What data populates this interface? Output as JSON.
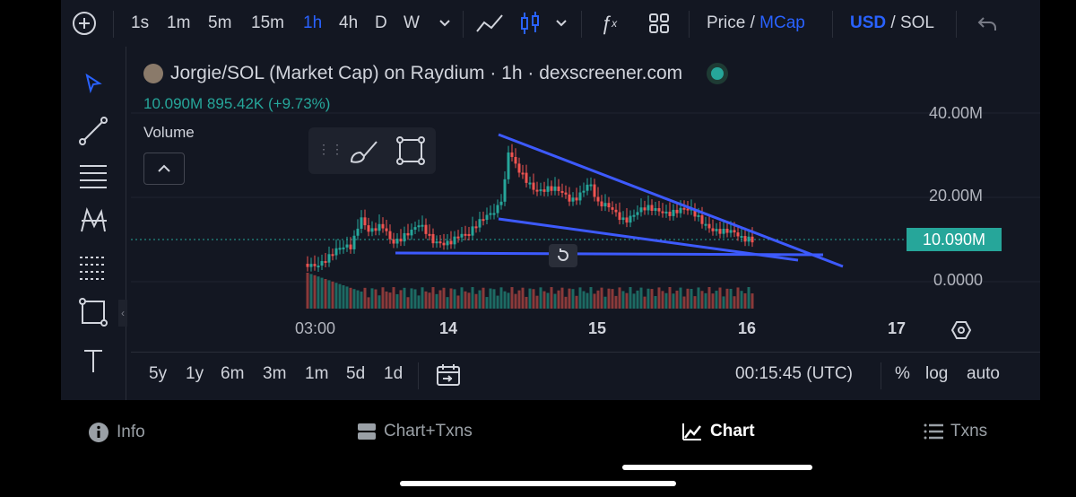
{
  "topbar": {
    "intervals": [
      "1s",
      "1m",
      "5m",
      "15m",
      "1h",
      "4h",
      "D",
      "W"
    ],
    "active_interval": "1h",
    "price_label": "Price /",
    "mcap_label": "MCap",
    "usd_label": "USD",
    "sol_label": "/ SOL"
  },
  "chart": {
    "title": "Jorgie/SOL (Market Cap) on Raydium · 1h · dexscreener.com",
    "last_value": "10.090M",
    "change_value": "895.42K",
    "change_pct": "(+9.73%)",
    "volume_label": "Volume",
    "y_ticks": [
      "40.00M",
      "20.00M",
      "0.0000"
    ],
    "price_tag": "10.090M",
    "x_ticks": [
      "03:00",
      "14",
      "15",
      "16",
      "17"
    ],
    "colors": {
      "up": "#26a69a",
      "down": "#ef5350",
      "trendline": "#3d5afe",
      "bg": "#131722"
    }
  },
  "chart_data": {
    "type": "candlestick",
    "title": "Jorgie/SOL (Market Cap) on Raydium · 1h · dexscreener.com",
    "ylabel": "",
    "ylim": [
      0,
      45000000
    ],
    "x": [
      "03:00",
      "14",
      "15",
      "16",
      "17"
    ],
    "last": 10090000
  },
  "bottombar": {
    "ranges": [
      "5y",
      "1y",
      "6m",
      "3m",
      "1m",
      "5d",
      "1d"
    ],
    "time": "00:15:45 (UTC)",
    "pct": "%",
    "log": "log",
    "auto": "auto"
  },
  "nav": {
    "info": "Info",
    "chart_txns": "Chart+Txns",
    "chart": "Chart",
    "txns": "Txns"
  }
}
